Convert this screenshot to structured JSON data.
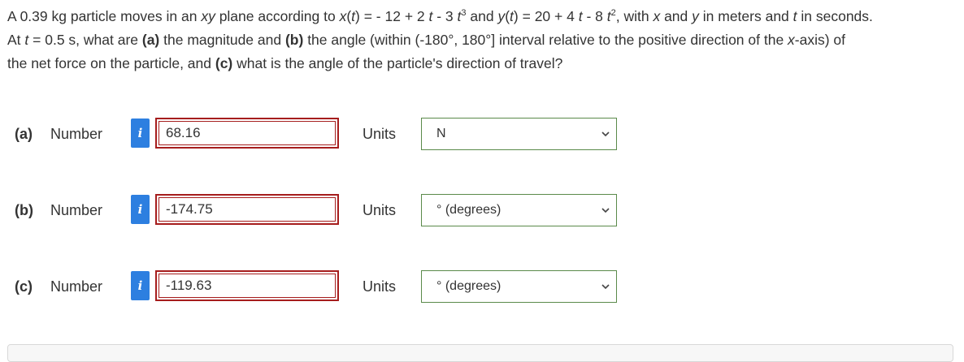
{
  "question": {
    "line1_a": "A 0.39 kg particle moves in an ",
    "line1_xy": "xy",
    "line1_b": " plane according to ",
    "line1_x": "x",
    "line1_c": "(",
    "line1_t1": "t",
    "line1_d": ") = - 12 + 2 ",
    "line1_t2": "t",
    "line1_e": " - 3 ",
    "line1_t3": "t",
    "line1_exp1": "3",
    "line1_f": " and ",
    "line1_y": "y",
    "line1_g": "(",
    "line1_t4": "t",
    "line1_h": ") = 20 + 4 ",
    "line1_t5": "t",
    "line1_i": " - 8 ",
    "line1_t6": "t",
    "line1_exp2": "2",
    "line1_j": ", with ",
    "line1_x2": "x",
    "line1_k": " and ",
    "line1_y2": "y",
    "line1_l": " in meters and ",
    "line1_t7": "t",
    "line1_m": " in seconds.",
    "line2_a": "At ",
    "line2_t": "t",
    "line2_b": " = 0.5 s, what are ",
    "line2_pa": "(a)",
    "line2_c": " the magnitude and ",
    "line2_pb": "(b)",
    "line2_d": " the angle (within (-180°, 180°] interval relative to the positive direction of the ",
    "line2_x": "x",
    "line2_e": "-axis) of",
    "line3_a": "the net force on the particle, and ",
    "line3_pc": "(c)",
    "line3_b": " what is the angle of the particle's direction of travel?"
  },
  "answers": [
    {
      "part": "(a)",
      "label": "Number",
      "info_icon": "i",
      "value": "68.16",
      "units_label": "Units",
      "unit": "N"
    },
    {
      "part": "(b)",
      "label": "Number",
      "info_icon": "i",
      "value": "-174.75",
      "units_label": "Units",
      "unit": "° (degrees)"
    },
    {
      "part": "(c)",
      "label": "Number",
      "info_icon": "i",
      "value": "-119.63",
      "units_label": "Units",
      "unit": "° (degrees)"
    }
  ],
  "colors": {
    "info_icon_bg": "#2d7fe0",
    "input_border_incorrect": "#a61d1d",
    "select_border": "#5a8a4a",
    "text": "#333333"
  }
}
